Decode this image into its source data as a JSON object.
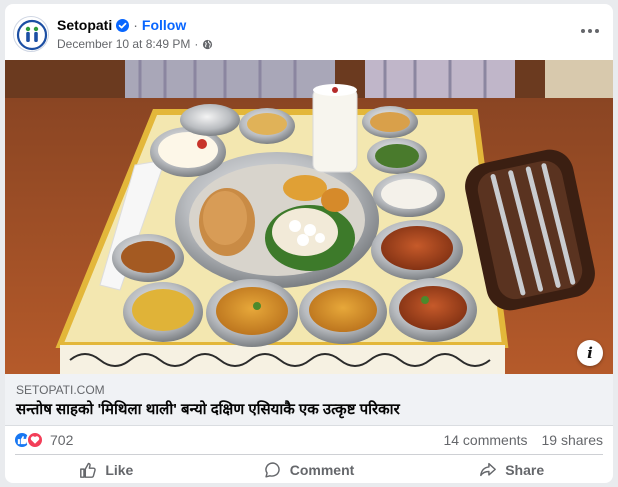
{
  "post": {
    "page_name": "Setopati",
    "separator": "·",
    "follow_label": "Follow",
    "timestamp": "December 10 at 8:49 PM",
    "meta_separator": "·",
    "audience_icon": "globe-icon",
    "more_icon": "more-options-icon",
    "verified_icon": "verified-badge-icon"
  },
  "photo": {
    "description_icon": "info-icon",
    "info_glyph": "i"
  },
  "link_preview": {
    "domain": "SETOPATI.COM",
    "headline": "सन्तोष साहको 'मिथिला थाली' बन्यो दक्षिण एसियाकै एक उत्कृष्ट परिकार"
  },
  "stats": {
    "reactions": [
      "like-reaction-icon",
      "love-reaction-icon"
    ],
    "reaction_count": "702",
    "comments": "14 comments",
    "shares": "19 shares"
  },
  "actions": {
    "like": "Like",
    "comment": "Comment",
    "share": "Share"
  },
  "colors": {
    "accent": "#0866ff",
    "like": "#1877f2",
    "love": "#f33e58",
    "muted_text": "#65676b"
  }
}
